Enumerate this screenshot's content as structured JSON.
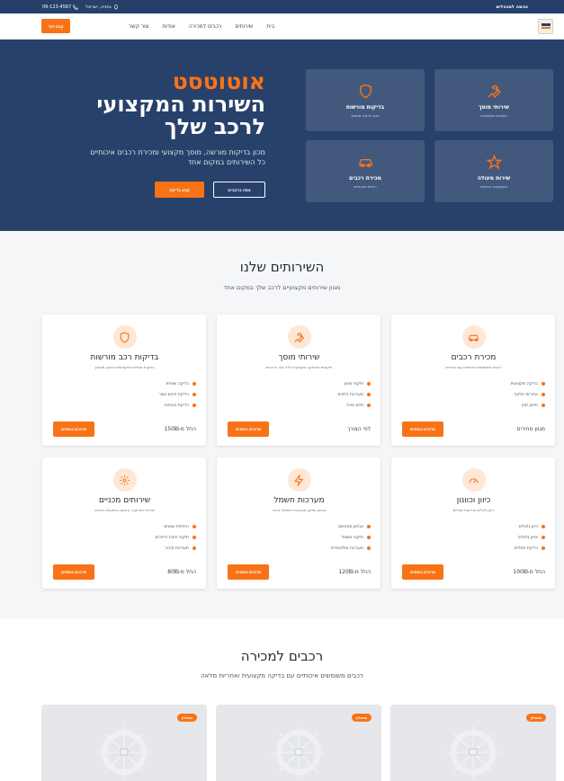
{
  "topbar": {
    "admin_link": "כניסה למנהלים",
    "location": "נתניה, ישראל",
    "phone": "09-123-4567"
  },
  "nav": {
    "links": [
      "בית",
      "שירותים",
      "רכבים למכירה",
      "אודות",
      "צור קשר"
    ],
    "appointment_button": "קבע תור"
  },
  "hero": {
    "brand": "אוטוטסט",
    "headline": "השירות המקצועי לרכב שלך",
    "subtitle_line1": "מכון בדיקות מורשה, מוסך מקצועי ומכירת רכבים איכותיים",
    "subtitle_line2": "כל השירותים במקום אחד",
    "primary_button": "קבע בדיקה",
    "secondary_button": "צפה ברכבים",
    "tiles": [
      {
        "icon": "wrench-icon",
        "title": "שירותי מוסך",
        "subtitle": "תיקונים מקצועיים"
      },
      {
        "icon": "shield-icon",
        "title": "בדיקות מורשות",
        "subtitle": "מכון בדיקה מוסמך"
      },
      {
        "icon": "star-icon",
        "title": "שירות מעולה",
        "subtitle": "מקצועיות ואמינות"
      },
      {
        "icon": "car-icon",
        "title": "מכירת רכבים",
        "subtitle": "רכבים איכותיים"
      }
    ]
  },
  "services": {
    "title": "השירותים שלנו",
    "subtitle": "מגוון שירותים מקצועיים לרכב שלך במקום אחד",
    "more_button": "פרטים נוספים",
    "cards": [
      {
        "icon": "car-icon",
        "title": "מכירת רכבים",
        "desc": "רכבים משומשים איכותיים עם אחריות",
        "items": [
          "בדיקה מקצועית",
          "אחריות מלאה",
          "מימון זמין"
        ],
        "price": "מגוון מחירים"
      },
      {
        "icon": "wrench-icon",
        "title": "שירותי מוסך",
        "desc": "תיקונים ותחזוקה מקצועית לכל סוגי הרכבים",
        "items": [
          "תיקוני מנוע",
          "מערכות בלמים",
          "מיזוג אוויר"
        ],
        "price": "לפי הצורך"
      },
      {
        "icon": "shield-icon",
        "title": "בדיקות רכב מורשות",
        "desc": "בדיקות שנתיות ותקופתיות במכון מוסמך",
        "items": [
          "בדיקה שנתית",
          "בדיקת זיהום אוויר",
          "בדיקת בטיחות"
        ],
        "price": "החל מ-150₪"
      },
      {
        "icon": "gauge-icon",
        "title": "כיוון וכוונון",
        "desc": "כיוון גלגלים ובדיקות מתלים",
        "items": [
          "כיוון גלגלים",
          "איזון גלגלים",
          "בדיקת מתלים"
        ],
        "price": "החל מ-100₪"
      },
      {
        "icon": "bolt-icon",
        "title": "מערכות חשמל",
        "desc": "אבחון ותיקון מערכות החשמל ברכב",
        "items": [
          "אבחון ממוחשב",
          "תיקוני חשמל",
          "מערכות מולטימדיה"
        ],
        "price": "החל מ-120₪"
      },
      {
        "icon": "gear-icon",
        "title": "שירותים מכניים",
        "desc": "שירותי תחזוקה, אחזקה ותיקונים מכניים",
        "items": [
          "החלפת שמנים",
          "תיקוני תיבת הילוכים",
          "מערכות קירור"
        ],
        "price": "החל מ-80₪"
      }
    ]
  },
  "cars": {
    "title": "רכבים למכירה",
    "subtitle": "רכבים משומשים איכותיים עם בדיקה מקצועית ואחריות מלאה",
    "badge": "מומלץ",
    "count": 3
  },
  "colors": {
    "accent": "#f97316",
    "navy": "#27416a",
    "topbar": "#25406a"
  }
}
